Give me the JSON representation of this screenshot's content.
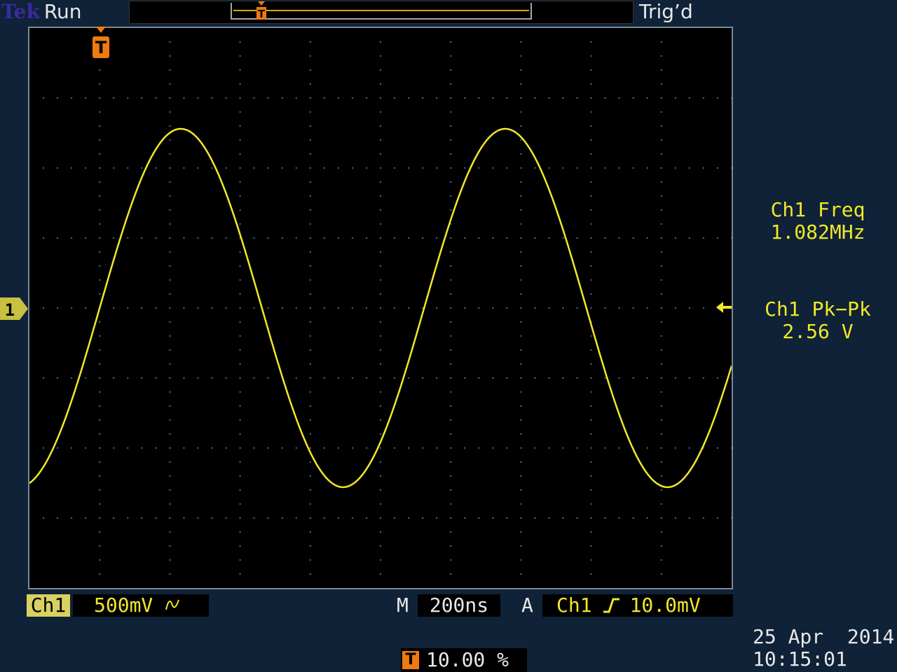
{
  "brand": {
    "maker": "Tek",
    "state": "Run"
  },
  "record_bar": {
    "trigger_marker": "T"
  },
  "trigger_status": "Trig’d",
  "markers": {
    "trigger_position": "T",
    "channel_ground": "1"
  },
  "measurements": {
    "freq": {
      "label": "Ch1 Freq",
      "value": "1.082MHz"
    },
    "pkpk": {
      "label": "Ch1 Pk−Pk",
      "value": "2.56 V"
    }
  },
  "channel": {
    "name": "Ch1",
    "scale": "500mV",
    "coupling_icon": "ac-coupling-icon"
  },
  "timebase": {
    "label": "M",
    "value": "200ns"
  },
  "trigger": {
    "mode_label": "A",
    "source": "Ch1",
    "slope_icon": "rising-edge-icon",
    "level": "10.0mV"
  },
  "trigger_position": {
    "icon": "T",
    "value": "10.00 %"
  },
  "datetime": {
    "date": "25 Apr  2014",
    "time": "10:15:01"
  },
  "colors": {
    "trace": "#f0e82a",
    "background": "#000000",
    "frame": "#0f2237",
    "trigger_marker": "#f07a10"
  },
  "chart_data": {
    "type": "line",
    "graticule": {
      "horizontal_divisions": 10,
      "vertical_divisions": 8
    },
    "series": [
      {
        "waveform": "sine",
        "frequency_hz": 1082000,
        "peak_to_peak_v": 2.56,
        "offset_v": 0.0,
        "volts_per_division": 0.5,
        "seconds_per_division": 2e-07,
        "trigger_position_percent": 10.0
      }
    ]
  }
}
